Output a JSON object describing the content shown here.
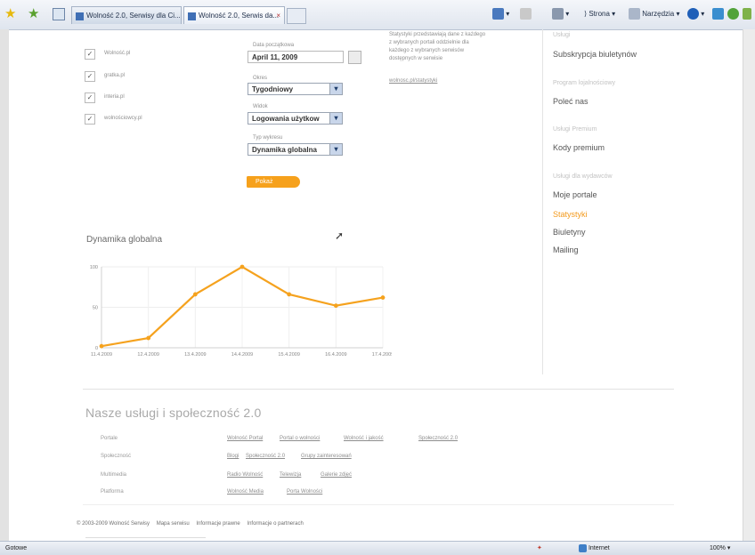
{
  "browser": {
    "tabs": [
      {
        "title": "Wolność 2.0, Serwisy dla Ci..."
      },
      {
        "title": "Wolność 2.0, Serwis da..."
      }
    ],
    "toolbar": {
      "page_label": "Strona",
      "tools_label": "Narzędzia"
    },
    "status": {
      "left": "Gotowe",
      "zone": "Internet",
      "zoom": "100%"
    },
    "colors": {
      "accent": "#f39a1d"
    }
  },
  "filters": {
    "checkboxes": [
      {
        "label": "Wolność.pl",
        "checked": true
      },
      {
        "label": "gratka.pl",
        "checked": true
      },
      {
        "label": "interia.pl",
        "checked": true
      },
      {
        "label": "wolnościowcy.pl",
        "checked": true
      }
    ],
    "date_label": "Data początkowa",
    "date_value": "April 11, 2009",
    "period_label": "Okres",
    "period_value": "Tygodniowy",
    "view_label": "Widok",
    "view_value": "Logowania użytkow",
    "type_label": "Typ wykresu",
    "type_value": "Dynamika globalna",
    "submit_label": "Pokaż"
  },
  "info": {
    "lines": [
      "Statystyki przedstawiają dane z każdego",
      "z wybranych portali oddzielnie dla",
      "każdego z wybranych serwisów",
      "dostępnych w serwisie"
    ],
    "link": "wolnosc.pl/statystyki"
  },
  "sidebar": {
    "sections": [
      {
        "head": "Usługi",
        "links": [
          "Subskrypcja biuletynów"
        ]
      },
      {
        "head": "Program lojalnościowy",
        "links": [
          "Poleć nas"
        ]
      },
      {
        "head": "Usługi Premium",
        "links": [
          "Kody premium"
        ]
      },
      {
        "head": "Usługi dla wydawców",
        "links": [
          "Moje portale",
          "Statystyki",
          "Biuletyny",
          "Mailing"
        ]
      }
    ],
    "active": "Statystyki"
  },
  "chart": {
    "title": "Dynamika globalna",
    "chart_data": {
      "type": "line",
      "x": [
        "11.4.2009",
        "12.4.2009",
        "13.4.2009",
        "14.4.2009",
        "15.4.2009",
        "16.4.2009",
        "17.4.2009"
      ],
      "series": [
        {
          "values": [
            2,
            12,
            66,
            100,
            66,
            52,
            62
          ]
        }
      ],
      "yticks": [
        "100",
        "50",
        "0"
      ],
      "ylim": [
        0,
        100
      ],
      "grid": true,
      "color": "#f5a21e"
    }
  },
  "footer": {
    "title": "Nasze usługi i społeczność 2.0",
    "rows": [
      {
        "label": "Portale",
        "links": [
          "Wolność Portal",
          "Portal o wolności",
          "Wolność i jakość",
          "Społeczność 2.0"
        ]
      },
      {
        "label": "Społeczność",
        "links": [
          "Blogi",
          "Społeczność 2.0",
          "Grupy zainteresowań"
        ]
      },
      {
        "label": "Multimedia",
        "links": [
          "Radio Wolność",
          "Telewizja",
          "Galerie zdjęć"
        ]
      },
      {
        "label": "Platforma",
        "links": [
          "Wolność Media",
          "Porta Wolności"
        ]
      }
    ],
    "copyright": "© 2003-2009 Wolność Serwisy",
    "links": [
      "Mapa serwisu",
      "Informacje prawne",
      "Informacje o partnerach"
    ]
  }
}
